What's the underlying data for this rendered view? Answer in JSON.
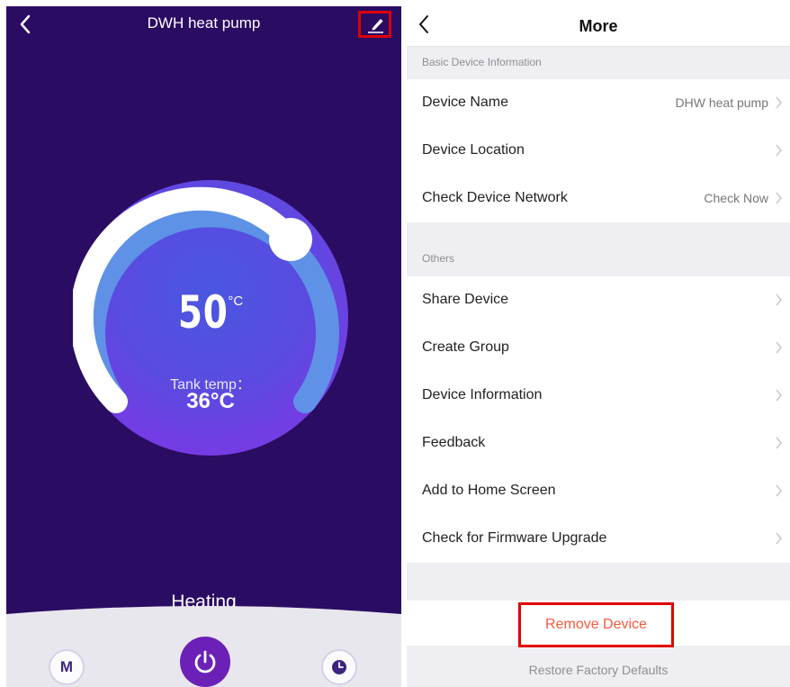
{
  "left": {
    "title": "DWH heat pump",
    "set_temp_value": "50",
    "set_temp_unit": "°C",
    "tank_label": "Tank temp：",
    "tank_value": "36°C",
    "status": "Heating",
    "mode_button": "M"
  },
  "right": {
    "title": "More",
    "section_basic": "Basic Device Information",
    "device_name_label": "Device Name",
    "device_name_value": "DHW heat pump",
    "device_location_label": "Device Location",
    "check_network_label": "Check Device Network",
    "check_network_value": "Check Now",
    "section_others": "Others",
    "share_device": "Share Device",
    "create_group": "Create Group",
    "device_information": "Device Information",
    "feedback": "Feedback",
    "add_home": "Add to Home Screen",
    "firmware": "Check for Firmware Upgrade",
    "remove_device": "Remove Device",
    "restore": "Restore Factory Defaults"
  },
  "colors": {
    "left_background": "#2a0c63",
    "power_button": "#6b21b8",
    "remove_text": "#f25a3c",
    "highlight_box": "#e00000"
  },
  "icons": [
    "back-icon",
    "edit-icon",
    "power-icon",
    "timer-icon",
    "chevron-right-icon"
  ]
}
